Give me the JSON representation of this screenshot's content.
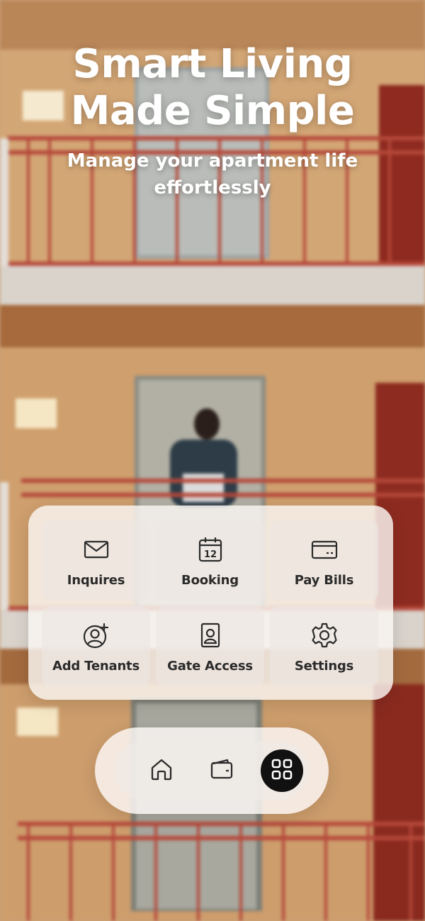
{
  "hero": {
    "title_line1": "Smart Living",
    "title_line2": "Made Simple",
    "subtitle": "Manage your apartment life effortlessly"
  },
  "menu": {
    "items": [
      {
        "label": "Inquires",
        "icon": "envelope-icon"
      },
      {
        "label": "Booking",
        "icon": "calendar-icon",
        "icon_text": "12"
      },
      {
        "label": "Pay Bills",
        "icon": "credit-card-icon"
      },
      {
        "label": "Add Tenants",
        "icon": "add-user-icon"
      },
      {
        "label": "Gate Access",
        "icon": "access-badge-icon"
      },
      {
        "label": "Settings",
        "icon": "gear-icon"
      }
    ]
  },
  "nav": {
    "items": [
      {
        "icon": "home-icon",
        "active": false
      },
      {
        "icon": "wallet-icon",
        "active": false
      },
      {
        "icon": "grid-icon",
        "active": true
      }
    ]
  },
  "colors": {
    "icon": "#2b2b2b",
    "active_nav_bg": "#111111",
    "railing": "#b5483a",
    "card_bg": "#faf6f3"
  }
}
